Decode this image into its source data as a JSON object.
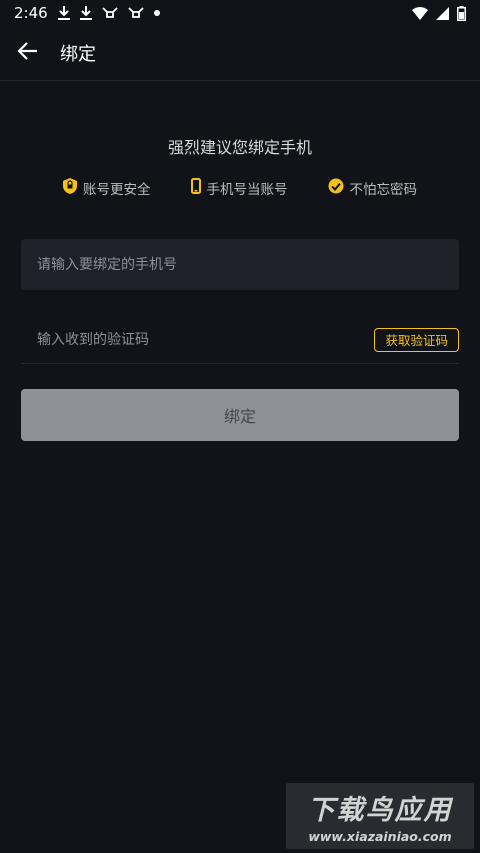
{
  "status_bar": {
    "time": "2:46"
  },
  "header": {
    "title": "绑定"
  },
  "headline": "强烈建议您绑定手机",
  "features": [
    {
      "icon": "shield-icon",
      "label": "账号更安全"
    },
    {
      "icon": "phone-icon",
      "label": "手机号当账号"
    },
    {
      "icon": "check-badge-icon",
      "label": "不怕忘密码"
    }
  ],
  "form": {
    "phone_placeholder": "请输入要绑定的手机号",
    "code_placeholder": "输入收到的验证码",
    "get_code_label": "获取验证码",
    "submit_label": "绑定"
  },
  "watermark": {
    "title": "下载鸟应用",
    "url": "www.xiazainiao.com"
  },
  "colors": {
    "accent": "#f2c21b",
    "background": "#111318",
    "field": "#1e2127",
    "button_disabled": "#8e9196"
  }
}
